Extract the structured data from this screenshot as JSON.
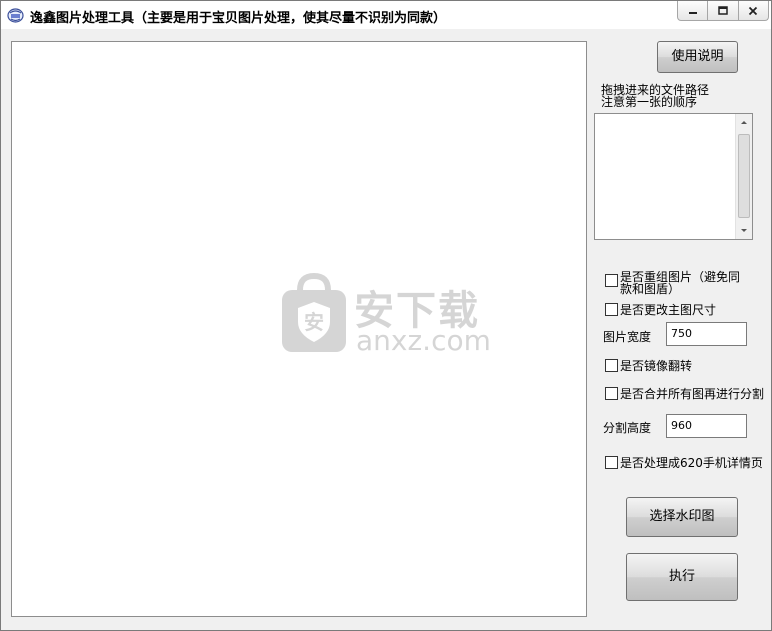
{
  "window": {
    "title": "逸鑫图片处理工具（主要是用于宝贝图片处理，使其尽量不识别为同款）"
  },
  "watermark": {
    "cn": "安下载",
    "en": "anxz.com"
  },
  "panel": {
    "help_button": "使用说明",
    "drag_hint_line1": "拖拽进来的文件路径",
    "drag_hint_line2": "注意第一张的顺序",
    "opt_regroup_line1": "是否重组图片（避免同",
    "opt_regroup_line2": "款和图盾）",
    "opt_resize": "是否更改主图尺寸",
    "width_label": "图片宽度",
    "width_value": "750",
    "opt_mirror": "是否镜像翻转",
    "opt_merge_split": "是否合并所有图再进行分割",
    "split_height_label": "分割高度",
    "split_height_value": "960",
    "opt_mobile": "是否处理成620手机详情页",
    "watermark_button": "选择水印图",
    "run_button": "执行"
  },
  "colors": {
    "window_bg": "#f0f0f0",
    "canvas_bg": "#ffffff"
  }
}
